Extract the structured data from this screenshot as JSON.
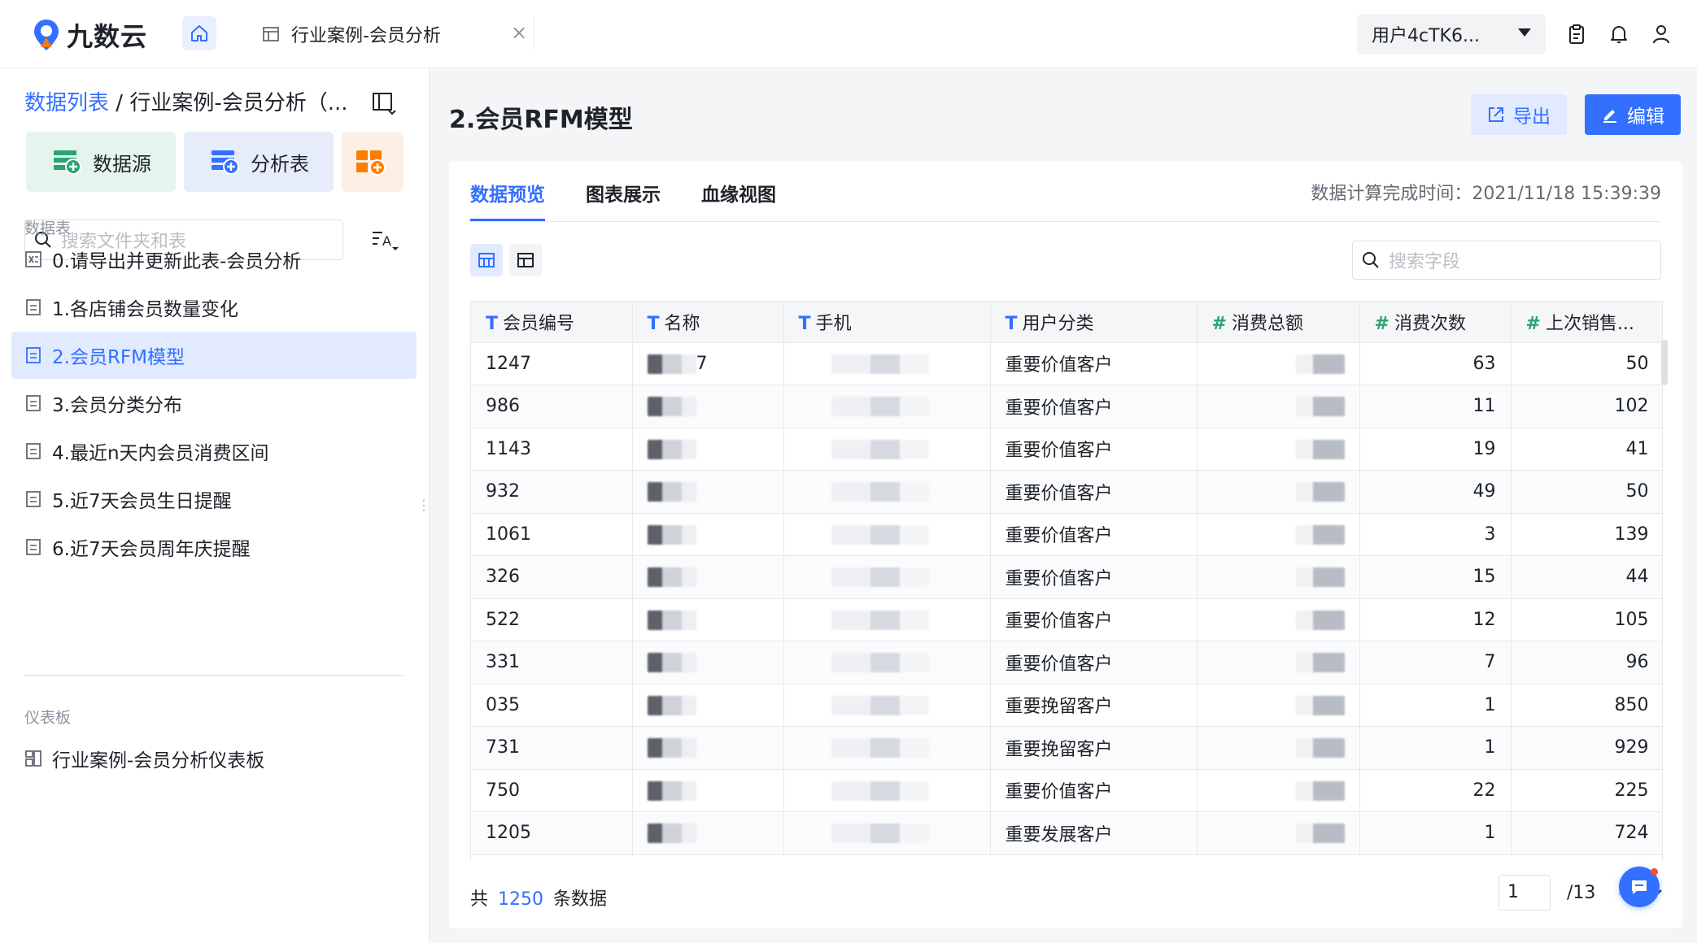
{
  "app": {
    "logo_text": "九数云"
  },
  "topbar": {
    "tab_label": "行业案例-会员分析",
    "tab_close": "×",
    "user_label": "用户4cTK6..."
  },
  "sidebar": {
    "breadcrumb_link": "数据列表",
    "breadcrumb_sep": " / ",
    "breadcrumb_current": "行业案例-会员分析（...",
    "btn_datasource": "数据源",
    "btn_analysis": "分析表",
    "search_placeholder": "搜索文件夹和表",
    "section_tables": "数据表",
    "section_dashboards": "仪表板",
    "items": [
      {
        "label": "0.请导出并更新此表-会员分析",
        "icon": "excel-table-icon"
      },
      {
        "label": "1.各店铺会员数量变化",
        "icon": "doc-icon"
      },
      {
        "label": "2.会员RFM模型",
        "icon": "doc-icon"
      },
      {
        "label": "3.会员分类分布",
        "icon": "doc-icon"
      },
      {
        "label": "4.最近n天内会员消费区间",
        "icon": "doc-icon"
      },
      {
        "label": "5.近7天会员生日提醒",
        "icon": "doc-icon"
      },
      {
        "label": "6.近7天会员周年庆提醒",
        "icon": "doc-icon"
      }
    ],
    "dashboards": [
      {
        "label": "行业案例-会员分析仪表板",
        "icon": "dashboard-icon"
      }
    ]
  },
  "main": {
    "title": "2.会员RFM模型",
    "export_label": "导出",
    "edit_label": "编辑",
    "tabs": [
      "数据预览",
      "图表展示",
      "血缘视图"
    ],
    "calc_time": "数据计算完成时间：2021/11/18 15:39:39",
    "field_search_placeholder": "搜索字段",
    "columns": [
      {
        "type": "T",
        "label": "会员编号"
      },
      {
        "type": "T",
        "label": "名称"
      },
      {
        "type": "T",
        "label": "手机"
      },
      {
        "type": "T",
        "label": "用户分类"
      },
      {
        "type": "#",
        "label": "消费总额"
      },
      {
        "type": "#",
        "label": "消费次数"
      },
      {
        "type": "#",
        "label": "上次销售..."
      }
    ],
    "rows": [
      {
        "id": "1247",
        "name": "7",
        "category": "重要价值客户",
        "times": "63",
        "last": "50"
      },
      {
        "id": "986",
        "name": "",
        "category": "重要价值客户",
        "times": "11",
        "last": "102"
      },
      {
        "id": "1143",
        "name": "",
        "category": "重要价值客户",
        "times": "19",
        "last": "41"
      },
      {
        "id": "932",
        "name": "",
        "category": "重要价值客户",
        "times": "49",
        "last": "50"
      },
      {
        "id": "1061",
        "name": "",
        "category": "重要价值客户",
        "times": "3",
        "last": "139"
      },
      {
        "id": "326",
        "name": "",
        "category": "重要价值客户",
        "times": "15",
        "last": "44"
      },
      {
        "id": "522",
        "name": "",
        "category": "重要价值客户",
        "times": "12",
        "last": "105"
      },
      {
        "id": "331",
        "name": "",
        "category": "重要价值客户",
        "times": "7",
        "last": "96"
      },
      {
        "id": "035",
        "name": "",
        "category": "重要挽留客户",
        "times": "1",
        "last": "850"
      },
      {
        "id": "731",
        "name": "",
        "category": "重要挽留客户",
        "times": "1",
        "last": "929"
      },
      {
        "id": "750",
        "name": "",
        "category": "重要价值客户",
        "times": "22",
        "last": "225"
      },
      {
        "id": "1205",
        "name": "",
        "category": "重要发展客户",
        "times": "1",
        "last": "724"
      }
    ],
    "footer_prefix": "共",
    "total_count": "1250",
    "footer_suffix": "条数据",
    "page_current": "1",
    "page_total": "/13"
  },
  "colors": {
    "primary": "#3370ff",
    "number_type": "#2ba471"
  }
}
